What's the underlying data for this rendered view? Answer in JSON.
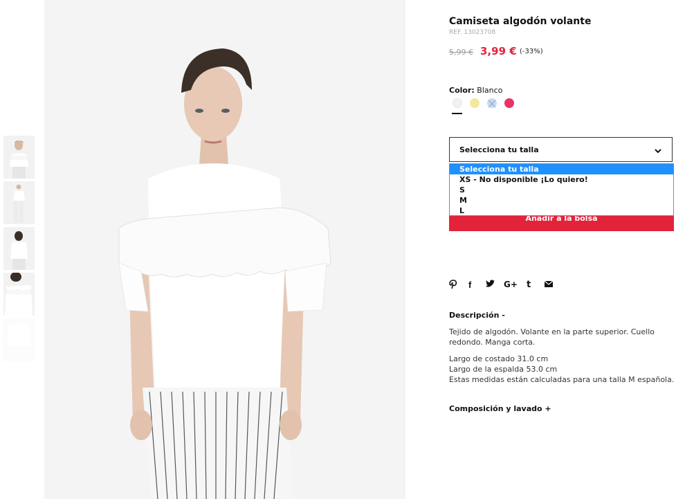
{
  "product": {
    "title": "Camiseta algodón volante",
    "ref": "REF. 13023708",
    "price_old": "5,99 €",
    "price_new": "3,99 €",
    "discount": "(-33%)"
  },
  "color": {
    "label": "Color:",
    "value": "Blanco",
    "swatches": [
      {
        "name": "white",
        "hex": "#f2f2f2"
      },
      {
        "name": "yellow",
        "hex": "#f5e79e"
      },
      {
        "name": "light-blue",
        "hex": "#c9dbef"
      },
      {
        "name": "pink",
        "hex": "#e93364"
      }
    ]
  },
  "size": {
    "select_label": "Selecciona tu talla",
    "options": [
      "Selecciona tu talla",
      "XS - No disponible ¡Lo quiero!",
      "S",
      "M",
      "L"
    ]
  },
  "add_button_label": "Añadir a la bolsa",
  "social": {
    "pinterest": "℗",
    "facebook": "f",
    "twitter": "🐦",
    "googleplus": "G+",
    "tumblr": "t",
    "email": "✉"
  },
  "description": {
    "title": "Descripción -",
    "text": "Tejido de algodón. Volante en la parte superior. Cuello redondo. Manga corta.",
    "measure_1": "Largo de costado 31.0 cm",
    "measure_2": "Largo de la espalda 53.0 cm",
    "measure_3": "Estas medidas están calculadas para una talla M española."
  },
  "composition_title": "Composición y lavado +",
  "colors": {
    "accent": "#e3233a",
    "highlight": "#1e90ff"
  }
}
